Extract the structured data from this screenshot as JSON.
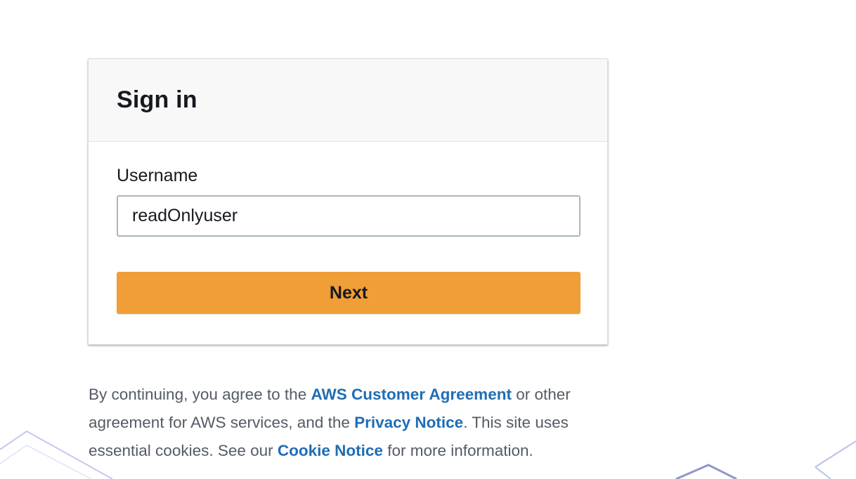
{
  "colors": {
    "accent_button": "#f09e38",
    "link": "#1f6db4",
    "header_bg": "#f8f8f8",
    "text": "#16191f",
    "muted_text": "#545b64"
  },
  "signin": {
    "title": "Sign in",
    "username_label": "Username",
    "username_value": "readOnlyuser",
    "next_label": "Next"
  },
  "legal": {
    "part1": "By continuing, you agree to the ",
    "customer_agreement": "AWS Customer Agreement",
    "part2": " or other agreement for AWS services, and the ",
    "privacy_notice": "Privacy Notice",
    "part3": ". This site uses essential cookies. See our ",
    "cookie_notice": "Cookie Notice",
    "part4": " for more information."
  }
}
